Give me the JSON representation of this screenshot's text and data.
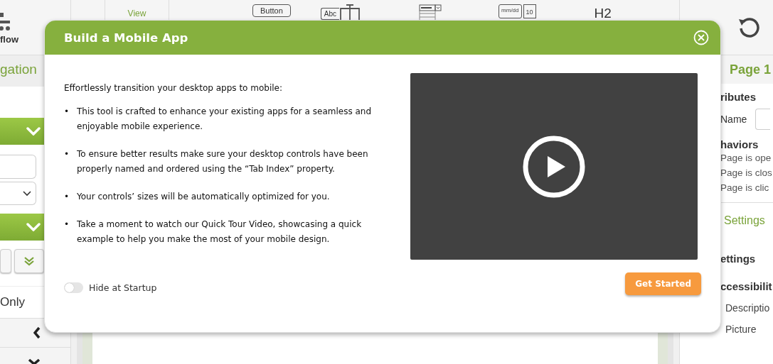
{
  "toolbar": {
    "workflow_label": "flow",
    "view_label": "View",
    "button_control": "Button",
    "text_control": "Abc",
    "date_control": "mm/dd",
    "date_day": "10",
    "heading_control": "H2"
  },
  "left_panel": {
    "navigation_label": "gation",
    "only_label": "Only"
  },
  "right_panel": {
    "page_title": "Page 1",
    "attributes_heading": "ributes",
    "name_label": "Name",
    "behaviors_heading": "haviors",
    "behaviors": [
      "Page is ope",
      "Page is clos",
      "Page is clic"
    ],
    "settings_tab": "Settings",
    "settings_heading": "ettings",
    "accessibility_heading": "ccessibilit",
    "accessibility_items": [
      "Descriptio",
      "Picture"
    ]
  },
  "dialog": {
    "title": "Build a Mobile App",
    "intro": "Effortlessly transition your desktop apps to mobile:",
    "bullet_marker": "•",
    "bullets": [
      "This tool is crafted to enhance your existing apps for a seamless and enjoyable mobile experience.",
      "To ensure better results make sure your desktop controls have been properly named and ordered using the “Tab Index” property.",
      "Your controls’ sizes will be automatically optimized for you.",
      "Take a moment to watch our Quick Tour Video, showcasing a quick example to help you make the most of your mobile design."
    ],
    "hide_at_startup": {
      "label": "Hide at Startup",
      "on": false
    },
    "primary_button": "Get Started"
  }
}
